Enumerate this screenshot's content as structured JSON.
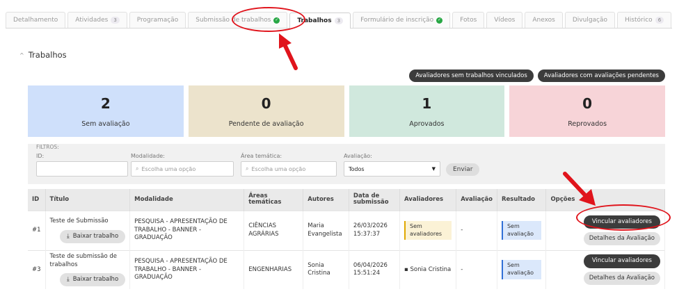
{
  "tabs": [
    {
      "label": "Detalhamento",
      "count": "",
      "check": false,
      "active": false
    },
    {
      "label": "Atividades",
      "count": "3",
      "check": false,
      "active": false
    },
    {
      "label": "Programação",
      "count": "",
      "check": false,
      "active": false
    },
    {
      "label": "Submissão de trabalhos",
      "count": "",
      "check": true,
      "active": false
    },
    {
      "label": "Trabalhos",
      "count": "3",
      "check": false,
      "active": true
    },
    {
      "label": "Formulário de inscrição",
      "count": "",
      "check": true,
      "active": false
    },
    {
      "label": "Fotos",
      "count": "",
      "check": false,
      "active": false
    },
    {
      "label": "Vídeos",
      "count": "",
      "check": false,
      "active": false
    },
    {
      "label": "Anexos",
      "count": "",
      "check": false,
      "active": false
    },
    {
      "label": "Divulgação",
      "count": "",
      "check": false,
      "active": false
    },
    {
      "label": "Histórico",
      "count": "6",
      "check": false,
      "active": false
    }
  ],
  "section": {
    "title": "Trabalhos"
  },
  "top_buttons": {
    "without_works": "Avaliadores sem trabalhos vinculados",
    "pending": "Avaliadores com avaliações pendentes"
  },
  "cards": [
    {
      "value": "2",
      "label": "Sem avaliação",
      "color": "#cfe0fb"
    },
    {
      "value": "0",
      "label": "Pendente de avaliação",
      "color": "#ece3cc"
    },
    {
      "value": "1",
      "label": "Aprovados",
      "color": "#d0e8dd"
    },
    {
      "value": "0",
      "label": "Reprovados",
      "color": "#f7d4d8"
    }
  ],
  "filters": {
    "title": "FILTROS:",
    "id_label": "ID:",
    "modalidade_label": "Modalidade:",
    "modalidade_placeholder": "Escolha uma opção",
    "area_label": "Área temática:",
    "area_placeholder": "Escolha uma opção",
    "avaliacao_label": "Avaliação:",
    "avaliacao_value": "Todos",
    "submit": "Enviar"
  },
  "table": {
    "headers": [
      "ID",
      "Título",
      "Modalidade",
      "Áreas temáticas",
      "Autores",
      "Data de submissão",
      "Avaliadores",
      "Avaliação",
      "Resultado",
      "Opções"
    ],
    "rows": [
      {
        "id": "#1",
        "title": "Teste de Submissão",
        "download": "Baixar trabalho",
        "modalidade": "PESQUISA - APRESENTAÇÃO DE TRABALHO - BANNER - GRADUAÇÃO",
        "area": "CIÊNCIAS AGRÁRIAS",
        "autores": "Maria Evangelista",
        "data": "26/03/2026 15:37:37",
        "avaliadores": "Sem avaliadores",
        "avaliacao": "-",
        "resultado": "Sem avaliação",
        "btn_vincular": "Vincular avaliadores",
        "btn_detalhes": "Detalhes da Avaliação"
      },
      {
        "id": "#3",
        "title": "Teste de submissão de trabalhos",
        "download": "Baixar trabalho",
        "modalidade": "PESQUISA - APRESENTAÇÃO DE TRABALHO - BANNER - GRADUAÇÃO",
        "area": "ENGENHARIAS",
        "autores": "Sonia Cristina",
        "data": "06/04/2026 15:51:24",
        "avaliadores": "Sonia Cristina",
        "avaliacao": "-",
        "resultado": "Sem avaliação",
        "btn_vincular": "Vincular avaliadores",
        "btn_detalhes": "Detalhes da Avaliação"
      }
    ]
  },
  "colors": {
    "annotation": "#e0141c",
    "dark_button": "#3c3c3c"
  }
}
